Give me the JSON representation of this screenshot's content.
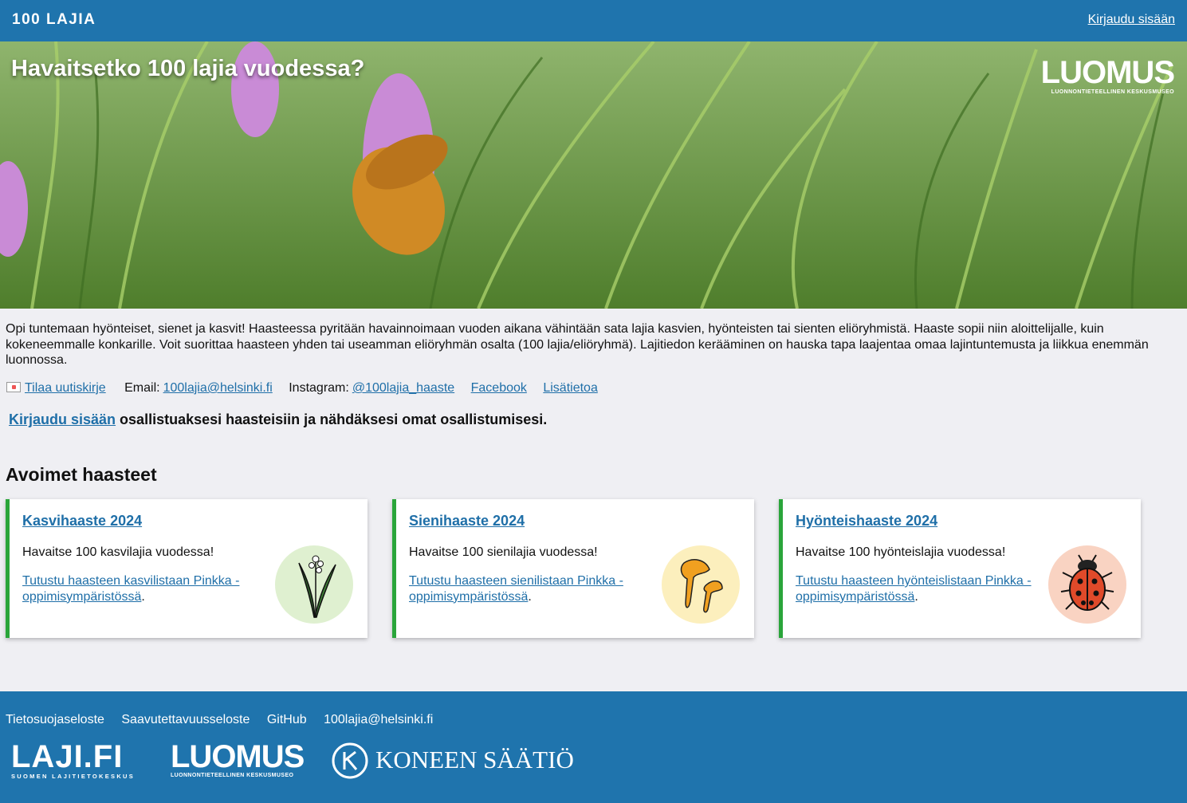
{
  "header": {
    "brand": "100 LAJIA",
    "login": "Kirjaudu sisään"
  },
  "hero": {
    "title": "Havaitsetko 100 lajia vuodessa?",
    "logo_big": "LUOMUS",
    "logo_small": "LUONNONTIETEELLINEN KESKUSMUSEO"
  },
  "intro": "Opi tuntemaan hyönteiset, sienet ja kasvit! Haasteessa pyritään havainnoimaan vuoden aikana vähintään sata lajia kasvien, hyönteisten tai sienten eliöryhmistä. Haaste sopii niin aloittelijalle, kuin kokeneemmalle konkarille. Voit suorittaa haasteen yhden tai useamman eliöryhmän osalta (100 lajia/eliöryhmä). Lajitiedon kerääminen on hauska tapa laajentaa omaa lajintuntemusta ja liikkua enemmän luonnossa.",
  "links": {
    "newsletter": "Tilaa uutiskirje",
    "email_label": "Email:",
    "email": "100lajia@helsinki.fi",
    "instagram_label": "Instagram:",
    "instagram": "@100lajia_haaste",
    "facebook": "Facebook",
    "more": "Lisätietoa"
  },
  "cta": {
    "link": "Kirjaudu sisään",
    "text": " osallistuaksesi haasteisiin ja nähdäksesi omat osallistumisesi."
  },
  "section_title": "Avoimet haasteet",
  "cards": [
    {
      "title": "Kasvihaaste 2024",
      "desc": "Havaitse 100 kasvilajia vuodessa!",
      "link": "Tutustu haasteen kasvilistaan Pinkka -oppimisympäristössä",
      "icon": "lily-of-the-valley-icon",
      "circle_color": "#dff0d0"
    },
    {
      "title": "Sienihaaste 2024",
      "desc": "Havaitse 100 sienilajia vuodessa!",
      "link": "Tutustu haasteen sienilistaan Pinkka -oppimisympäristössä",
      "icon": "chanterelle-icon",
      "circle_color": "#fcefbd"
    },
    {
      "title": "Hyönteishaaste 2024",
      "desc": "Havaitse 100 hyönteislajia vuodessa!",
      "link": "Tutustu haasteen hyönteislistaan Pinkka -oppimisympäristössä",
      "icon": "ladybug-icon",
      "circle_color": "#f9d3c2"
    }
  ],
  "footer": {
    "links": [
      "Tietosuojaseloste",
      "Saavutettavuusseloste",
      "GitHub",
      "100lajia@helsinki.fi"
    ],
    "laji_big": "LAJI.FI",
    "laji_small": "SUOMEN LAJITIETOKESKUS",
    "luomus_big": "LUOMUS",
    "luomus_small": "LUONNONTIETEELLINEN KESKUSMUSEO",
    "kone": "KONEEN SÄÄTIÖ"
  },
  "colors": {
    "primary": "#1f74ad",
    "link": "#1f6fa8",
    "card_accent": "#2aa53a",
    "background": "#efeff3"
  }
}
